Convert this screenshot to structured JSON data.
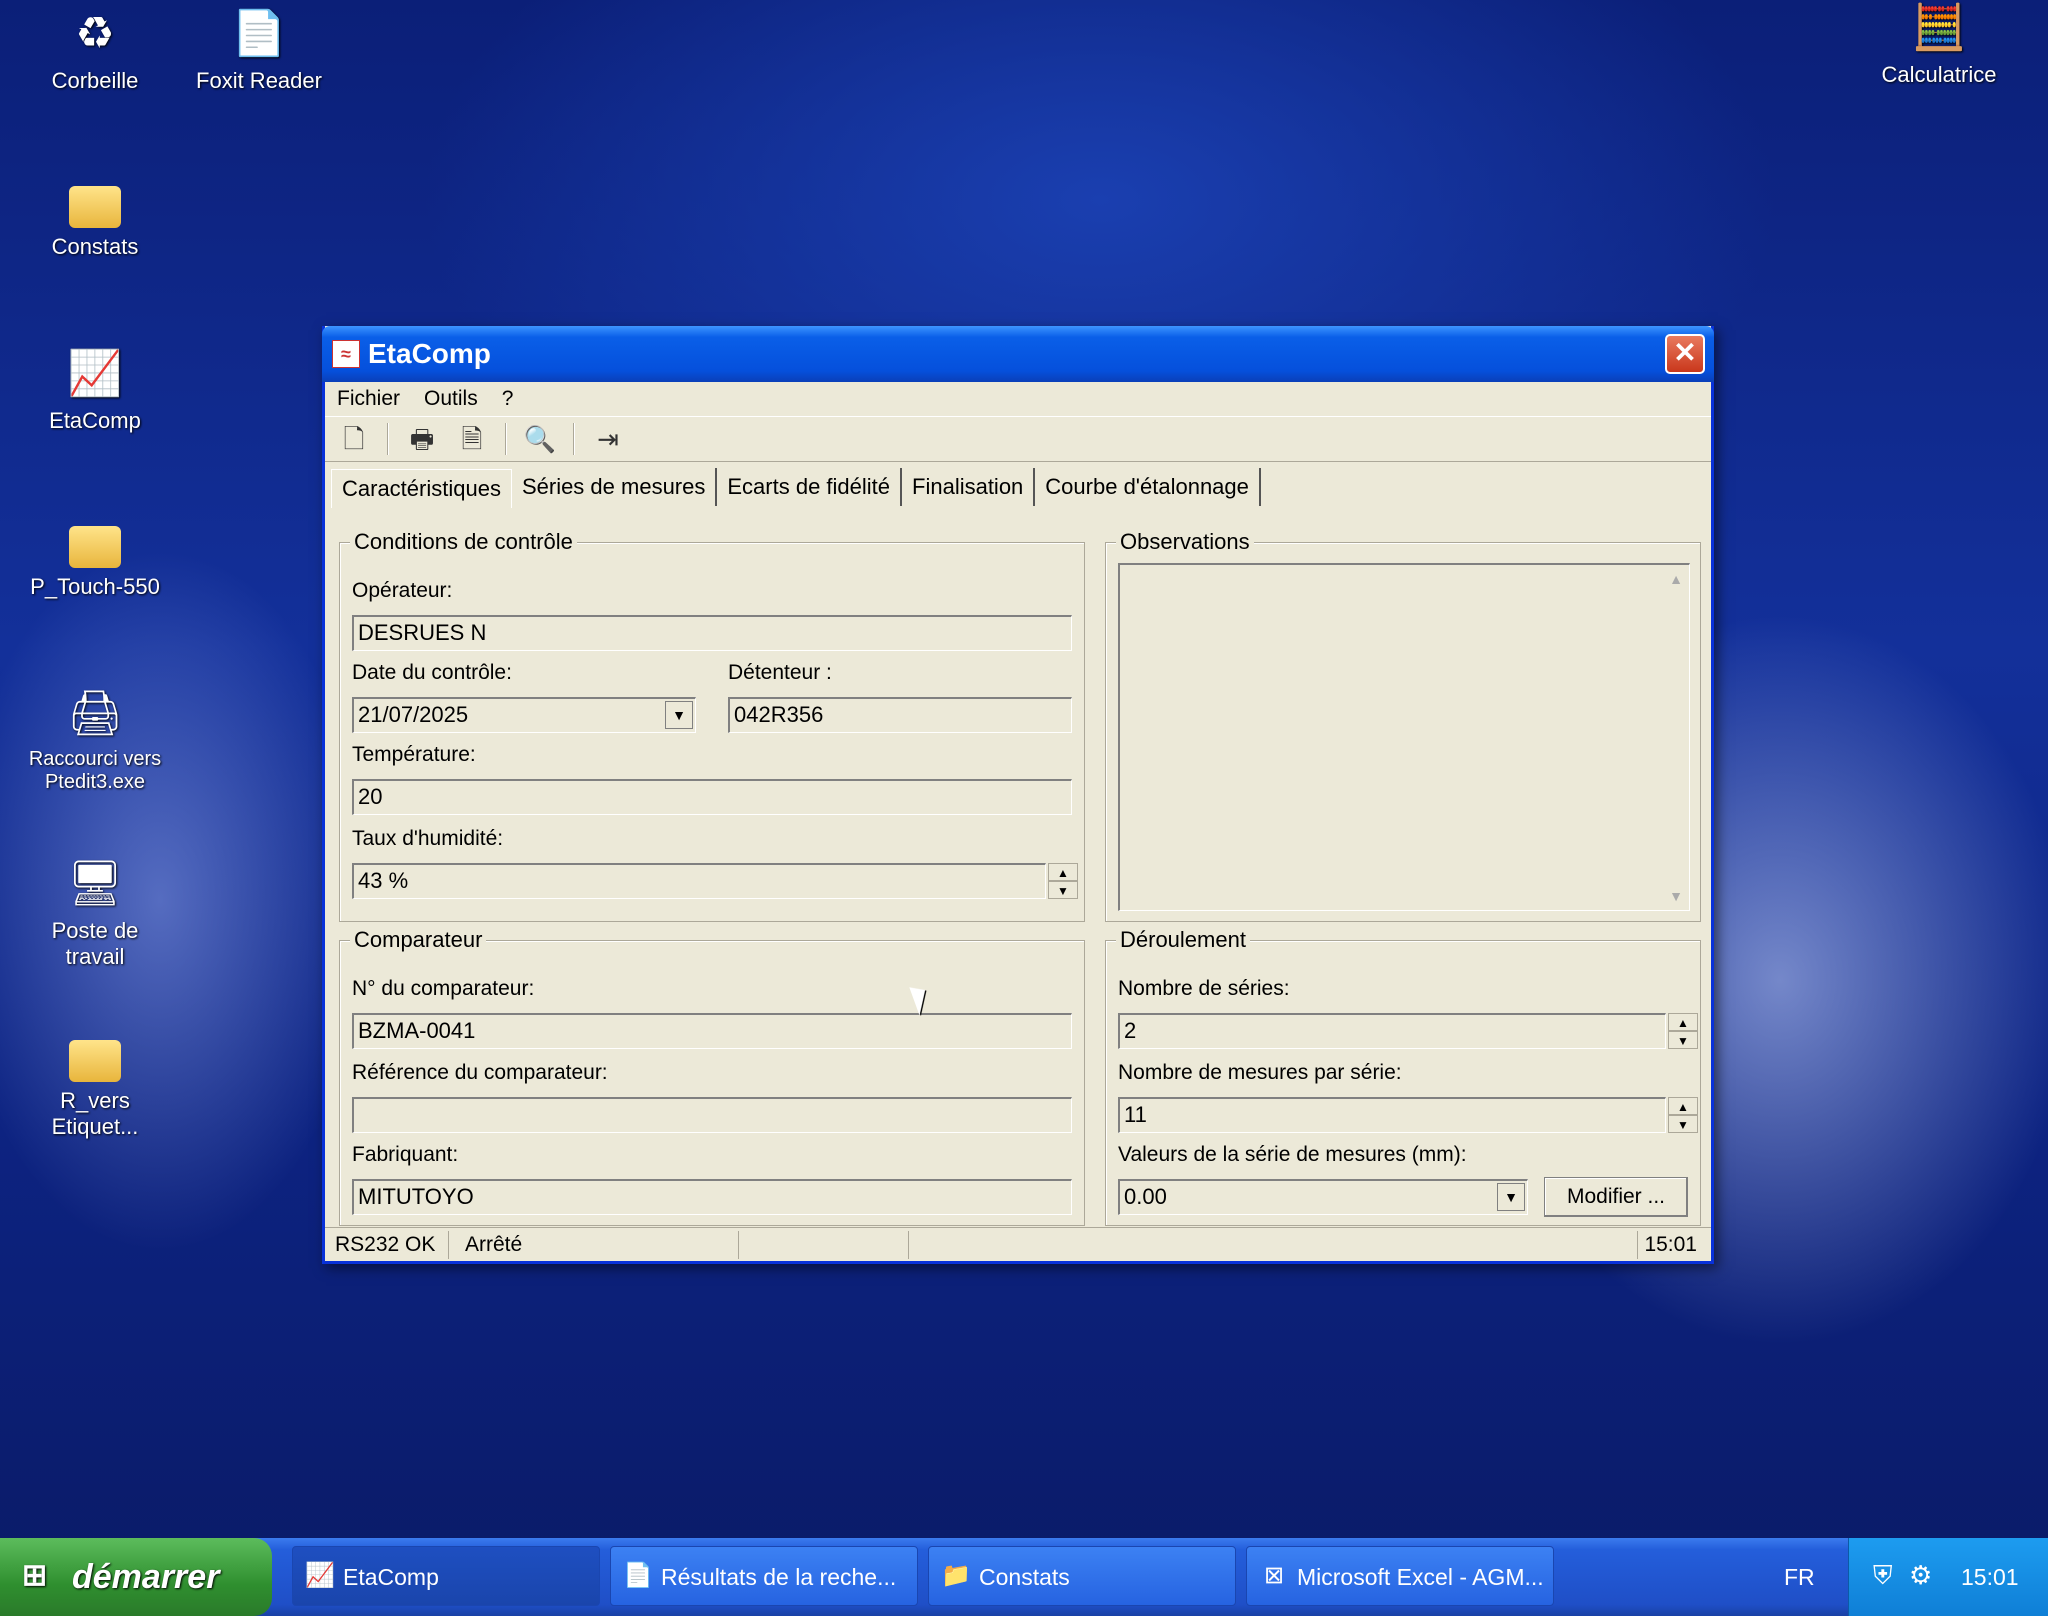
{
  "desktop": {
    "icons": [
      {
        "label": "Corbeille",
        "glyph": "♻"
      },
      {
        "label": "Foxit Reader",
        "glyph": "📄"
      },
      {
        "label": "Constats",
        "glyph": ""
      },
      {
        "label": "EtaComp",
        "glyph": "📈"
      },
      {
        "label": "P_Touch-550",
        "glyph": ""
      },
      {
        "label": "Raccourci vers Ptedit3.exe",
        "glyph": "🖨"
      },
      {
        "label": "Poste de travail",
        "glyph": "🖥"
      },
      {
        "label": "R_vers Etiquet...",
        "glyph": ""
      },
      {
        "label": "Calculatrice",
        "glyph": "🧮"
      }
    ]
  },
  "window": {
    "title": "EtaComp",
    "close_glyph": "✕",
    "menu": [
      "Fichier",
      "Outils",
      "?"
    ],
    "toolbar": {
      "new": "🗋",
      "print": "🖶",
      "preview": "🗎",
      "search": "🔍",
      "exit": "⇥"
    },
    "tabs": [
      "Caractéristiques",
      "Séries de mesures",
      "Ecarts de fidélité",
      "Finalisation",
      "Courbe d'étalonnage"
    ],
    "conditions": {
      "title": "Conditions de contrôle",
      "operator_label": "Opérateur:",
      "operator_value": "DESRUES N",
      "date_label": "Date du contrôle:",
      "date_value": "21/07/2025",
      "holder_label": "Détenteur :",
      "holder_value": "042R356",
      "temperature_label": "Température:",
      "temperature_value": "20",
      "humidity_label": "Taux d'humidité:",
      "humidity_value": "43 %"
    },
    "observations": {
      "title": "Observations"
    },
    "comparator": {
      "title": "Comparateur",
      "number_label": "N° du comparateur:",
      "number_value": "BZMA-0041",
      "reference_label": "Référence du comparateur:",
      "reference_value": "",
      "maker_label": "Fabriquant:",
      "maker_value": "MITUTOYO"
    },
    "progress": {
      "title": "Déroulement",
      "series_label": "Nombre de séries:",
      "series_value": "2",
      "measures_label": "Nombre de mesures par série:",
      "measures_value": "11",
      "values_label": "Valeurs de la série de mesures (mm):",
      "values_value": "0.00",
      "modify_label": "Modifier ..."
    },
    "status": {
      "port": "RS232 OK",
      "state": "Arrêté",
      "time": "15:01"
    }
  },
  "taskbar": {
    "start_label": "démarrer",
    "buttons": [
      "EtaComp",
      "Résultats de la reche...",
      "Constats",
      "Microsoft Excel - AGM..."
    ],
    "language": "FR",
    "clock": "15:01"
  }
}
